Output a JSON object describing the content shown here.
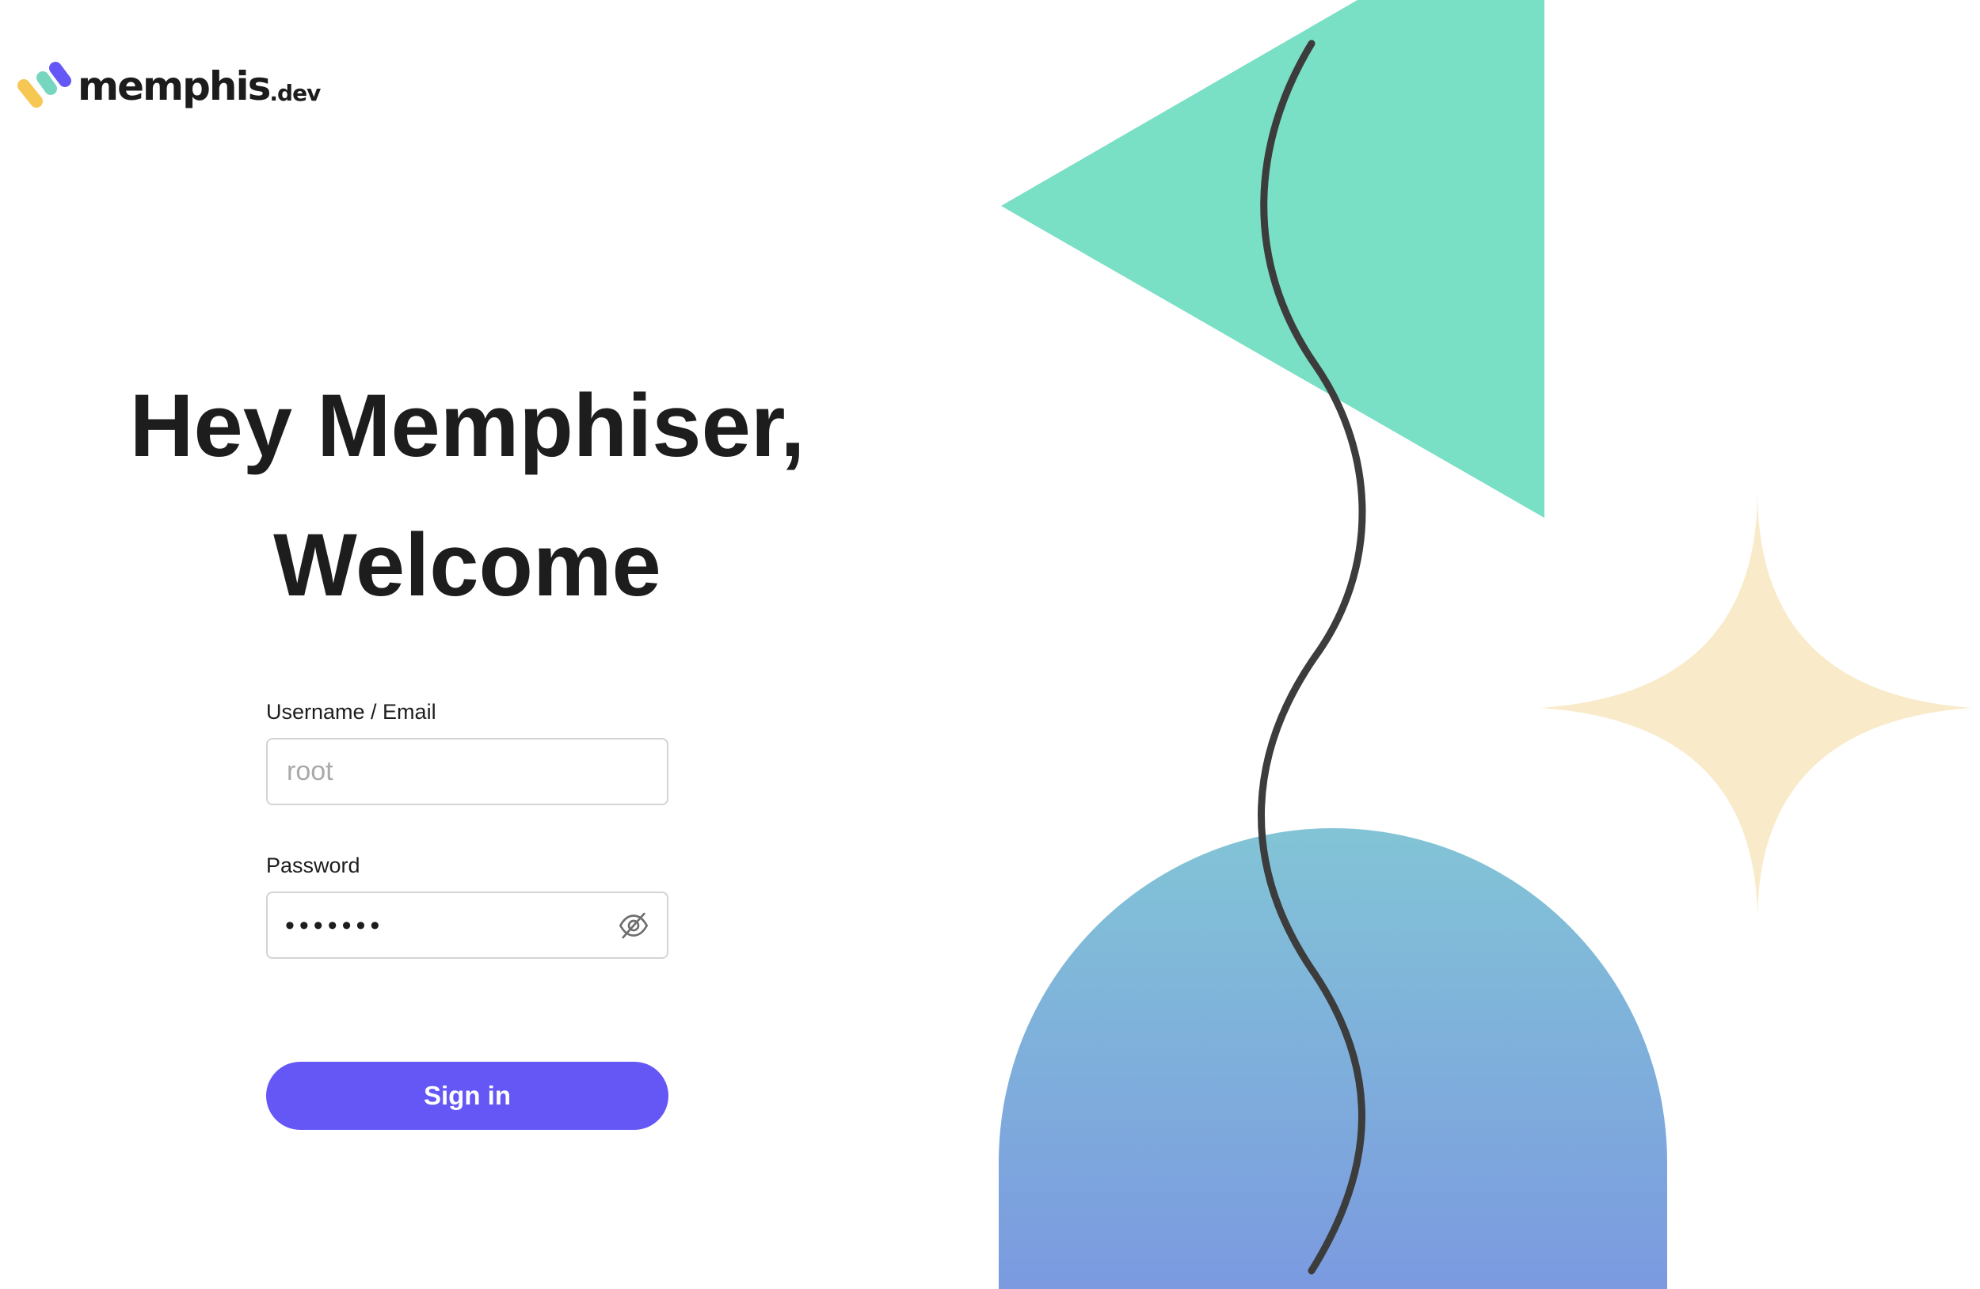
{
  "brand": {
    "name": "memphis",
    "suffix": ".dev"
  },
  "welcome": {
    "line1": "Hey Memphiser,",
    "line2": "Welcome"
  },
  "form": {
    "username_label": "Username / Email",
    "username_placeholder": "root",
    "username_value": "",
    "password_label": "Password",
    "password_value_masked": "•••••••",
    "signin_label": "Sign in"
  },
  "icons": {
    "password_toggle": "eye-off-icon"
  },
  "colors": {
    "accent": "#6557f5",
    "triangle": "#79dfc5",
    "star": "#f9ebc9",
    "arch_top": "#82c4d6",
    "arch_bottom": "#7b9ae0",
    "squiggle": "#3c3c3c"
  }
}
